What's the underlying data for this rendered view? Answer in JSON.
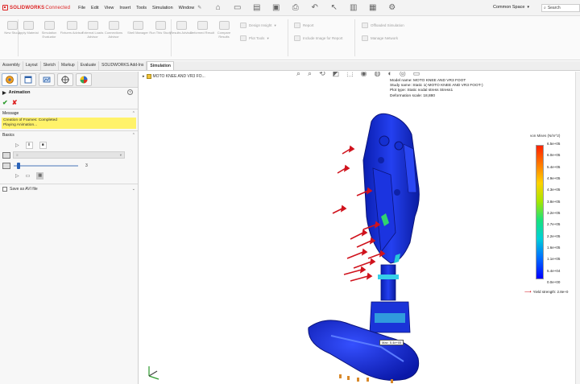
{
  "app": {
    "brand": "SOLIDWORKS",
    "brand_suffix": "Connected",
    "menus": [
      "File",
      "Edit",
      "View",
      "Insert",
      "Tools",
      "Simulation",
      "Window"
    ],
    "space": "Common Space",
    "search_placeholder": "Search"
  },
  "ribbon": {
    "buttons": [
      "New Study",
      "Apply Material",
      "Simulation Evaluator",
      "Fixtures Advisor",
      "External Loads Advisor",
      "Connections Advisor",
      "Shell Manager",
      "Run This Study",
      "Results Advisor",
      "Deformed Result",
      "Compare Results"
    ],
    "rows": [
      "Design Insight",
      "Plot Tools",
      "Report",
      "Include Image for Report",
      "Offloaded Simulation",
      "Manage Network"
    ]
  },
  "tabs": {
    "items": [
      "Assembly",
      "Layout",
      "Sketch",
      "Markup",
      "Evaluate",
      "SOLIDWORKS Add-Ins",
      "Simulation"
    ],
    "active": "Simulation"
  },
  "property_manager": {
    "title": "Animation",
    "help": "?",
    "message_header": "Message",
    "message_lines": [
      "Creation of Frames: Completed",
      "Playing Animation..."
    ],
    "basics_header": "Basics",
    "slider_value": "3",
    "slider_fraction": 0.05,
    "save_label": "Save as AVI file"
  },
  "graphics": {
    "tree_label": "MOTO KNEE AND VR3 FO...",
    "info_lines": [
      "Model name: MOTO KNEE AND VR3 FOOT",
      "Study name: Static 1(-MOTO KNEE AND VR3 FOOT-)",
      "Plot type: Static nodal stress Stress1",
      "Deformation scale: 18,880"
    ],
    "legend_title": "von Mises (N/m^2)",
    "legend_values": [
      "6.5e+05",
      "6.0e+05",
      "5.4e+05",
      "4.9e+05",
      "4.3e+05",
      "3.8e+05",
      "3.2e+05",
      "2.7e+05",
      "2.2e+05",
      "1.6e+05",
      "1.1e+05",
      "5.4e+04",
      "0.0e+00"
    ],
    "yield_label": "Yield strength: 2.8e+0",
    "probe_label": "Max: 5.4e+05"
  },
  "colors": {
    "brand": "#dd2222",
    "active_tab_bg": "#ffffff",
    "message_bg": "#fff26a",
    "model_blue": "#1c2fd6",
    "force_arrow": "#d0131d"
  }
}
